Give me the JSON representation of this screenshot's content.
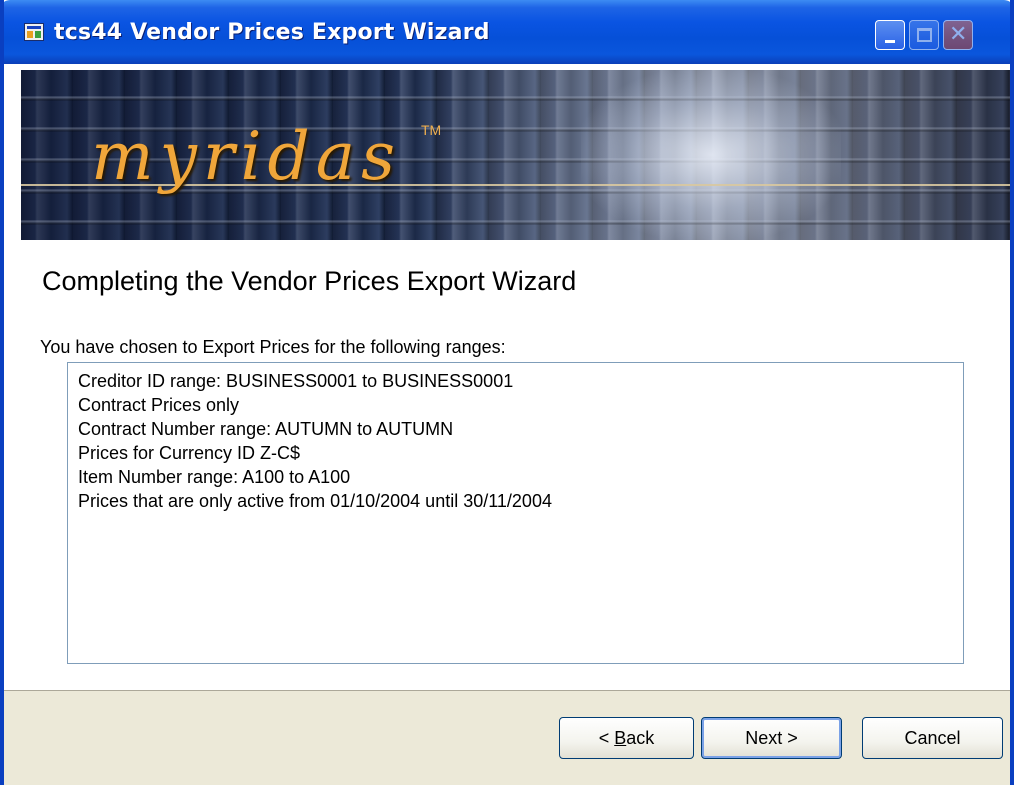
{
  "window": {
    "title": "tcs44 Vendor Prices Export Wizard"
  },
  "banner": {
    "logo": "myridas",
    "trademark": "TM"
  },
  "content": {
    "heading": "Completing the Vendor Prices Export Wizard",
    "intro": "You have chosen to Export Prices for the following ranges:",
    "ranges": [
      "Creditor ID range: BUSINESS0001 to BUSINESS0001",
      "Contract Prices only",
      "Contract Number range: AUTUMN to AUTUMN",
      "Prices for Currency ID Z-C$",
      "Item Number range: A100 to A100",
      "Prices that are only active from 01/10/2004 until 30/11/2004"
    ]
  },
  "buttons": {
    "back_prefix": "< ",
    "back_mnemonic": "B",
    "back_rest": "ack",
    "next": "Next >",
    "cancel": "Cancel"
  },
  "icons": {
    "app": "app-window-icon",
    "minimize": "minimize-icon",
    "maximize": "maximize-icon",
    "close": "close-icon"
  }
}
